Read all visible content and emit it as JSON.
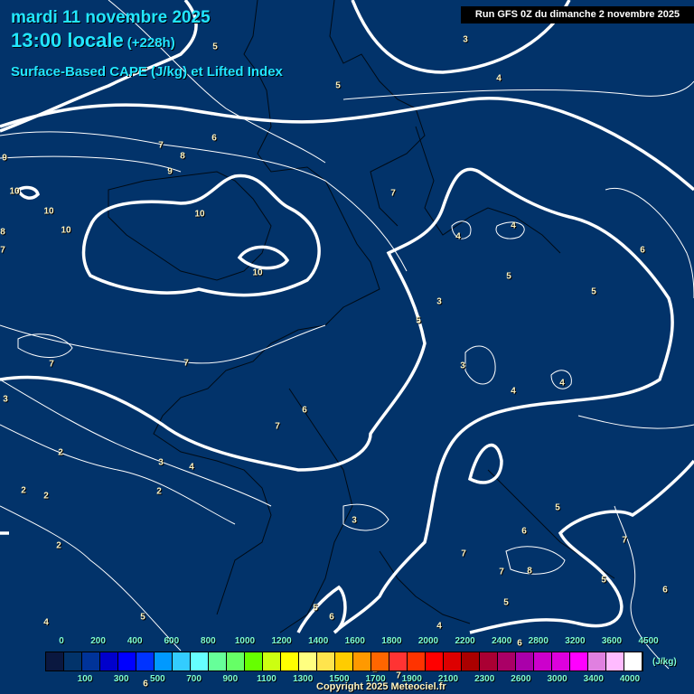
{
  "header": {
    "date": "mardi 11 novembre 2025",
    "time": "13:00 locale",
    "lead": "(+228h)",
    "parameter": "Surface-Based CAPE (J/kg) et Lifted Index",
    "run": "Run GFS 0Z du dimanche 2 novembre 2025"
  },
  "map": {
    "background_color": "#02336a",
    "contour_labels": [
      "5",
      "3",
      "5",
      "4",
      "7",
      "6",
      "8",
      "9",
      "9",
      "10",
      "10",
      "10",
      "10",
      "8",
      "7",
      "10",
      "7",
      "4",
      "4",
      "5",
      "6",
      "5",
      "3",
      "5",
      "3",
      "4",
      "4",
      "7",
      "7",
      "6",
      "7",
      "3",
      "3",
      "4",
      "2",
      "2",
      "2",
      "2",
      "2",
      "3",
      "5",
      "6",
      "6",
      "7",
      "7",
      "8",
      "5",
      "5",
      "7",
      "6",
      "5",
      "4",
      "5",
      "4",
      "6",
      "2",
      "7",
      "6"
    ]
  },
  "legend": {
    "unit": "(J/kg)",
    "top_ticks": [
      "0",
      "200",
      "400",
      "600",
      "800",
      "1000",
      "1200",
      "1400",
      "1600",
      "1800",
      "2000",
      "2200",
      "2400",
      "2800",
      "3200",
      "3600",
      "4500"
    ],
    "bottom_ticks": [
      "100",
      "300",
      "500",
      "700",
      "900",
      "1100",
      "1300",
      "1500",
      "1700",
      "1900",
      "2100",
      "2300",
      "2600",
      "3000",
      "3400",
      "4000"
    ],
    "colors": [
      "#0a1840",
      "#02336a",
      "#003399",
      "#0000cc",
      "#0000ff",
      "#0033ff",
      "#0099ff",
      "#33ccff",
      "#66ffff",
      "#66ff99",
      "#66ff66",
      "#66ff00",
      "#ccff11",
      "#ffff00",
      "#ffff80",
      "#ffe44d",
      "#ffcc00",
      "#ff9900",
      "#ff6600",
      "#ff3333",
      "#ff3300",
      "#ff0000",
      "#dd0000",
      "#aa0000",
      "#aa0033",
      "#aa0066",
      "#aa00aa",
      "#cc00cc",
      "#dd00dd",
      "#ff00ff",
      "#e080e0",
      "#ffbbff",
      "#ffffff"
    ]
  },
  "footer": {
    "copyright": "Copyright 2025 Meteociel.fr"
  }
}
